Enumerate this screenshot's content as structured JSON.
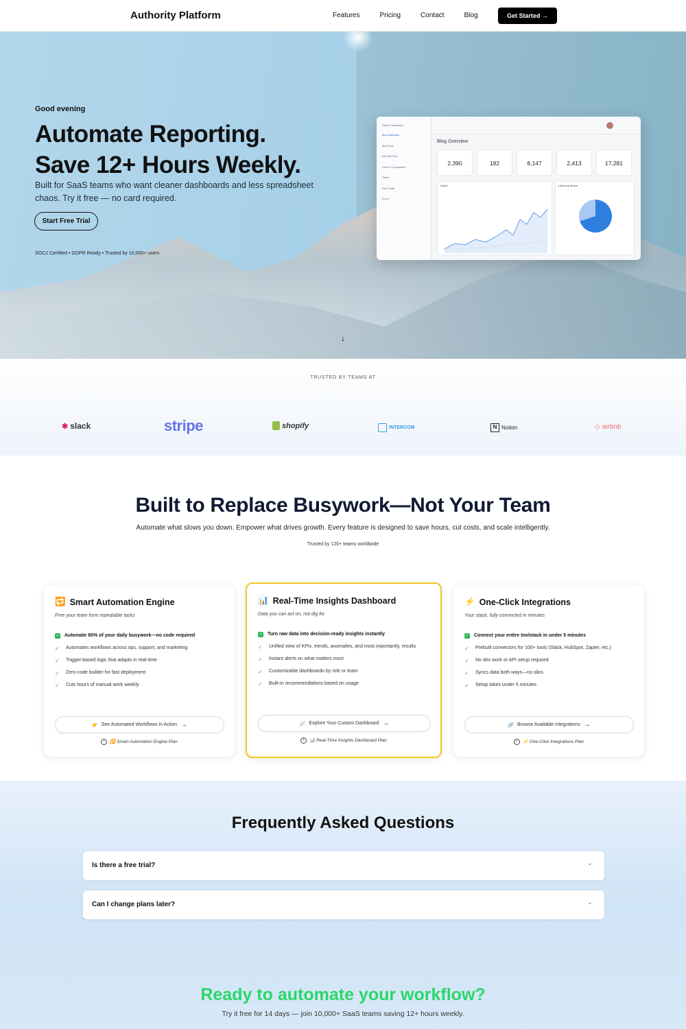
{
  "nav": {
    "brand": "Authority Platform",
    "links": [
      "Features",
      "Pricing",
      "Contact",
      "Blog"
    ],
    "cta": "Get Started →"
  },
  "hero": {
    "greeting": "Good evening",
    "headline_line1": "Automate Reporting.",
    "headline_line2": "Save 12+ Hours Weekly.",
    "subtext": "Built for SaaS teams who want cleaner dashboards and less spreadsheet chaos. Try it free — no card required.",
    "trial_button": "Start Free Trial",
    "certifications": "SOC2 Certified • GDPR Ready • Trusted by 10,000+ users",
    "scroll_arrow": "↓"
  },
  "dashboard_mock": {
    "search": "Search Dashboards",
    "menu": [
      "Blog Dashboard",
      "Blog Posts",
      "Add New Post",
      "Forms & Components",
      "Tables",
      "User Profile",
      "Errors"
    ],
    "title": "Blog Overview",
    "kpis": [
      "2,390",
      "182",
      "8,147",
      "2,413",
      "17,281"
    ],
    "panel_users": "Users",
    "panel_device": "Users by device",
    "pie_fraction_main": 0.7
  },
  "trusted": {
    "label": "TRUSTED BY TEAMS AT",
    "logos": [
      "slack",
      "stripe",
      "shopify",
      "INTERCOM",
      "Notion",
      "airbnb"
    ]
  },
  "features": {
    "title": "Built to Replace Busywork—Not Your Team",
    "subtitle": "Automate what slows you down. Empower what drives growth. Every feature is designed to save hours, cut costs, and scale intelligently.",
    "trust_note": "Trusted by 120+ teams worldwide",
    "cards": [
      {
        "icon": "🔁",
        "title": "Smart Automation Engine",
        "subtitle": "Free your team from repeatable tasks",
        "highlight": "Automate 80% of your daily busywork—no code required",
        "bullets": [
          "Automates workflows across ops, support, and marketing",
          "Trigger-based logic that adapts in real-time",
          "Zero-code builder for fast deployment",
          "Cuts hours of manual work weekly"
        ],
        "button": "See Automated Workflows in Action",
        "button_icon": "👉",
        "plan": "Smart Automation Engine Plan",
        "plan_icon": "🔁"
      },
      {
        "icon": "📊",
        "title": "Real-Time Insights Dashboard",
        "subtitle": "Data you can act on, not dig for",
        "highlight": "Turn raw data into decision-ready insights instantly",
        "bullets": [
          "Unified view of KPIs, trends, anomalies, and most importantly, results",
          "Instant alerts on what matters most",
          "Customizable dashboards by role or team",
          "Built-in recommendations based on usage"
        ],
        "button": "Explore Your Custom Dashboard",
        "button_icon": "📈",
        "plan": "Real-Time Insights Dashboard Plan",
        "plan_icon": "📊"
      },
      {
        "icon": "⚡",
        "title": "One-Click Integrations",
        "subtitle": "Your stack, fully connected in minutes",
        "highlight": "Connect your entire toolstack in under 5 minutes",
        "bullets": [
          "Prebuilt connectors for 100+ tools (Slack, HubSpot, Zapier, etc.)",
          "No dev work or API setup required",
          "Syncs data both ways—no silos",
          "Setup takes under 5 minutes"
        ],
        "button": "Browse Available Integrations",
        "button_icon": "🔗",
        "plan": "One-Click Integrations Plan",
        "plan_icon": "⚡"
      }
    ]
  },
  "faq": {
    "title": "Frequently Asked Questions",
    "questions": [
      "Is there a free trial?",
      "Can I change plans later?"
    ]
  },
  "cta_section": {
    "title": "Ready to automate your workflow?",
    "subtitle": "Try it free for 14 days — join 10,000+ SaaS teams saving 12+ hours weekly."
  },
  "colors": {
    "accent_green": "#2bd66a",
    "highlight_border": "#f3c623",
    "check_green": "#2fb55a"
  }
}
